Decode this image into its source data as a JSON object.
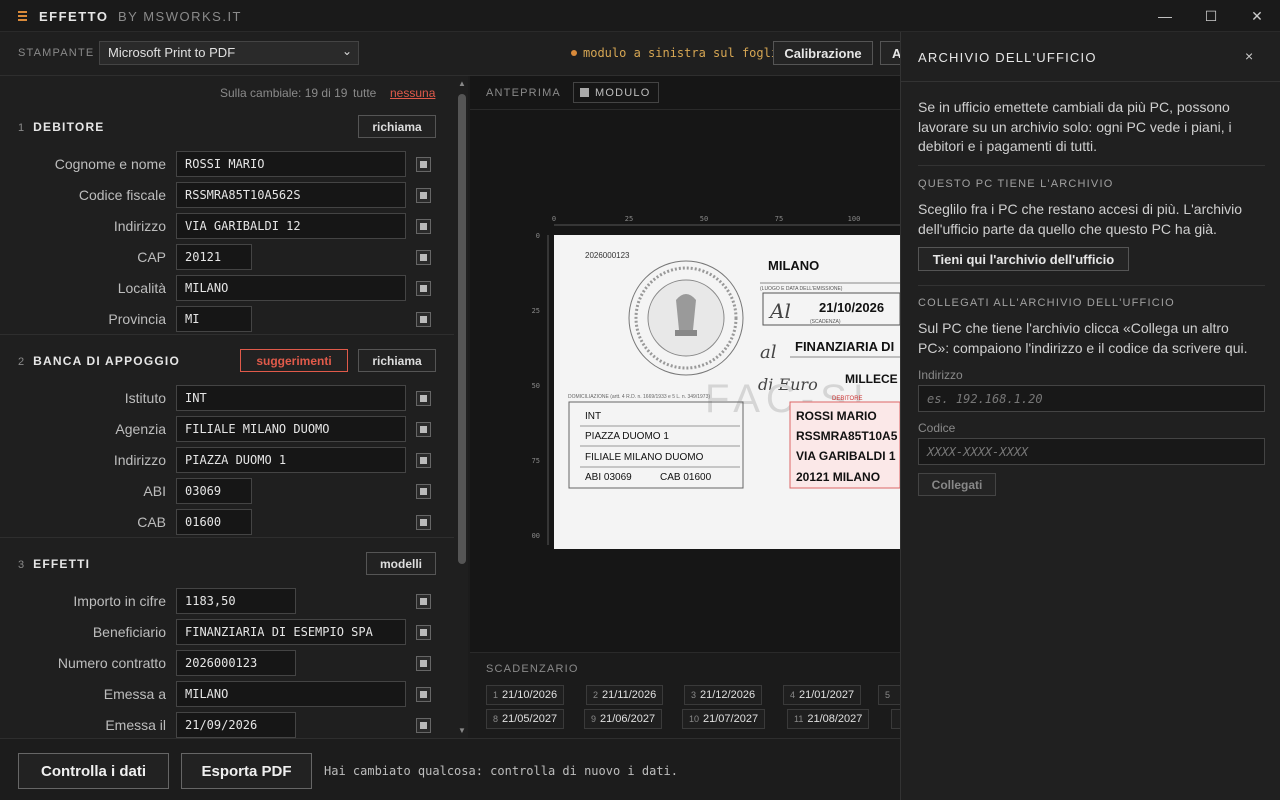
{
  "app": {
    "name": "EFFETTO",
    "by": "BY MSWORKS.IT"
  },
  "window": {
    "minimize": "—",
    "maximize": "☐",
    "close": "✕"
  },
  "toolbar": {
    "printer_label": "STAMPANTE",
    "printer_value": "Microsoft Print to PDF",
    "hint": "modulo a sinistra sul foglio",
    "calibrazione": "Calibrazione",
    "truncated_btn": "A"
  },
  "cambiale": {
    "count": "Sulla cambiale: 19 di 19",
    "tutte": "tutte",
    "nessuna": "nessuna"
  },
  "debitore": {
    "num": "1",
    "title": "DEBITORE",
    "richiama": "richiama",
    "fields": [
      {
        "label": "Cognome e nome",
        "value": "ROSSI MARIO"
      },
      {
        "label": "Codice fiscale",
        "value": "RSSMRA85T10A562S"
      },
      {
        "label": "Indirizzo",
        "value": "VIA GARIBALDI 12"
      },
      {
        "label": "CAP",
        "value": "20121"
      },
      {
        "label": "Località",
        "value": "MILANO"
      },
      {
        "label": "Provincia",
        "value": "MI"
      }
    ]
  },
  "banca": {
    "num": "2",
    "title": "BANCA DI APPOGGIO",
    "suggerimenti": "suggerimenti",
    "richiama": "richiama",
    "fields": [
      {
        "label": "Istituto",
        "value": "INT"
      },
      {
        "label": "Agenzia",
        "value": "FILIALE MILANO DUOMO"
      },
      {
        "label": "Indirizzo",
        "value": "PIAZZA DUOMO 1"
      },
      {
        "label": "ABI",
        "value": "03069"
      },
      {
        "label": "CAB",
        "value": "01600"
      }
    ]
  },
  "effetti": {
    "num": "3",
    "title": "EFFETTI",
    "modelli": "modelli",
    "fields": [
      {
        "label": "Importo in cifre",
        "value": "1183,50"
      },
      {
        "label": "Beneficiario",
        "value": "FINANZIARIA DI ESEMPIO SPA"
      },
      {
        "label": "Numero contratto",
        "value": "2026000123"
      },
      {
        "label": "Emessa a",
        "value": "MILANO"
      },
      {
        "label": "Emessa il",
        "value": "21/09/2026"
      }
    ]
  },
  "preview": {
    "label": "ANTEPRIMA",
    "modulo": "MODULO",
    "ruler_top": [
      "0",
      "25",
      "50",
      "75",
      "100"
    ],
    "ruler_left": [
      "0",
      "25",
      "50",
      "75",
      "00"
    ],
    "doc": {
      "contratto": "2026000123",
      "luogo": "MILANO",
      "luogo_caption": "(LUOGO E DATA DELL'EMISSIONE)",
      "al_label": "Al",
      "scadenza": "21/10/2026",
      "scadenza_caption": "(SCADENZA)",
      "beneficiario_prefix": "al",
      "beneficiario": "FINANZIARIA DI",
      "euro_prefix": "di Euro",
      "importo_lettere": "MILLECE",
      "watermark": "FAC-SI",
      "domiciliazione_caption": "DOMICILIAZIONE (artt. 4 R.D. n. 1669/1933 e 5 L. n. 349/1973)",
      "banca_lines": [
        "INT",
        "PIAZZA DUOMO 1",
        "FILIALE MILANO DUOMO"
      ],
      "abi": "ABI  03069",
      "cab": "CAB 01600",
      "debitore_caption": "DEBITORE",
      "debitore_lines": [
        "ROSSI MARIO",
        "RSSMRA85T10A5",
        "VIA GARIBALDI 1",
        "20121  MILANO"
      ]
    }
  },
  "scadenzario": {
    "label": "SCADENZARIO",
    "row1": [
      {
        "n": "1",
        "d": "21/10/2026"
      },
      {
        "n": "2",
        "d": "21/11/2026"
      },
      {
        "n": "3",
        "d": "21/12/2026"
      },
      {
        "n": "4",
        "d": "21/01/2027"
      },
      {
        "n": "5",
        "d": ""
      }
    ],
    "row2": [
      {
        "n": "8",
        "d": "21/05/2027"
      },
      {
        "n": "9",
        "d": "21/06/2027"
      },
      {
        "n": "10",
        "d": "21/07/2027"
      },
      {
        "n": "11",
        "d": "21/08/2027"
      },
      {
        "n": "",
        "d": ""
      }
    ]
  },
  "bottom": {
    "controlla": "Controlla i dati",
    "esporta": "Esporta PDF",
    "message": "Hai cambiato qualcosa: controlla di nuovo i dati."
  },
  "archivio": {
    "title": "ARCHIVIO DELL'UFFICIO",
    "close": "×",
    "intro": "Se in ufficio emettete cambiali da più PC, possono lavorare su un archivio solo: ogni PC vede i piani, i debitori e i pagamenti di tutti.",
    "tiene_heading": "QUESTO PC TIENE L'ARCHIVIO",
    "tiene_text": "Sceglilo fra i PC che restano accesi di più. L'archivio dell'ufficio parte da quello che questo PC ha già.",
    "tiene_button": "Tieni qui l'archivio dell'ufficio",
    "collega_heading": "COLLEGATI ALL'ARCHIVIO DELL'UFFICIO",
    "collega_text": "Sul PC che tiene l'archivio clicca «Collega un altro PC»: compaiono l'indirizzo e il codice da scrivere qui.",
    "indirizzo_label": "Indirizzo",
    "indirizzo_placeholder": "es. 192.168.1.20",
    "codice_label": "Codice",
    "codice_placeholder": "XXXX-XXXX-XXXX",
    "collegati_button": "Collegati"
  },
  "colors": {
    "accent": "#d98a3a",
    "danger": "#e05a4a",
    "bg": "#1c1c1c"
  }
}
